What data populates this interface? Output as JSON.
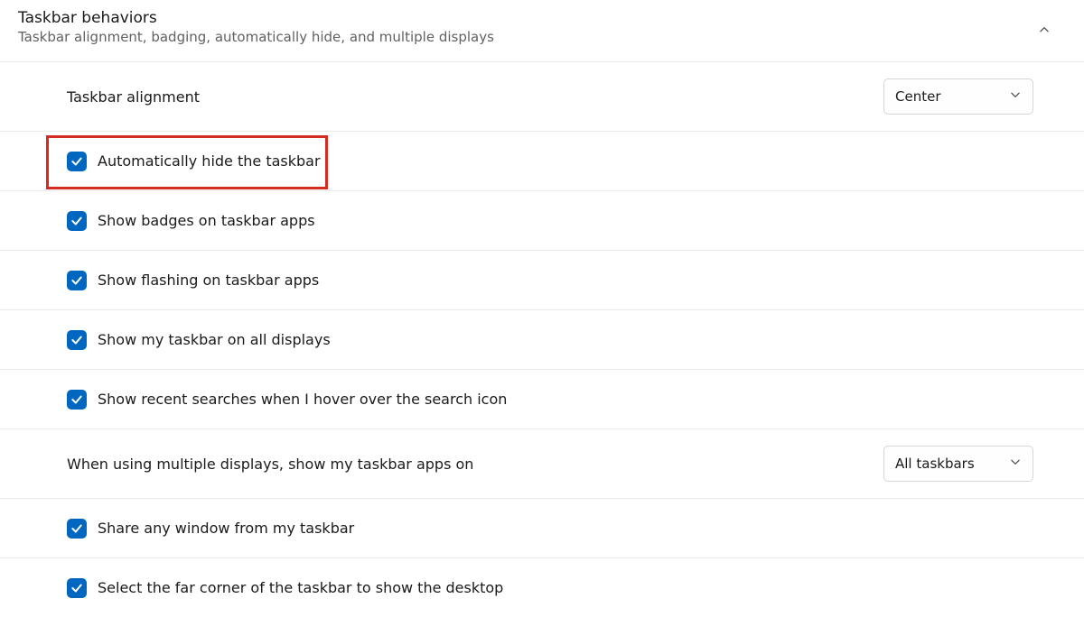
{
  "section": {
    "title": "Taskbar behaviors",
    "subtitle": "Taskbar alignment, badging, automatically hide, and multiple displays"
  },
  "alignment_row": {
    "label": "Taskbar alignment",
    "value": "Center"
  },
  "checks": {
    "auto_hide": "Automatically hide the taskbar",
    "badges": "Show badges on taskbar apps",
    "flashing": "Show flashing on taskbar apps",
    "all_displays": "Show my taskbar on all displays",
    "recent_searches": "Show recent searches when I hover over the search icon",
    "share_window": "Share any window from my taskbar",
    "far_corner": "Select the far corner of the taskbar to show the desktop"
  },
  "multi_display_row": {
    "label": "When using multiple displays, show my taskbar apps on",
    "value": "All taskbars"
  }
}
